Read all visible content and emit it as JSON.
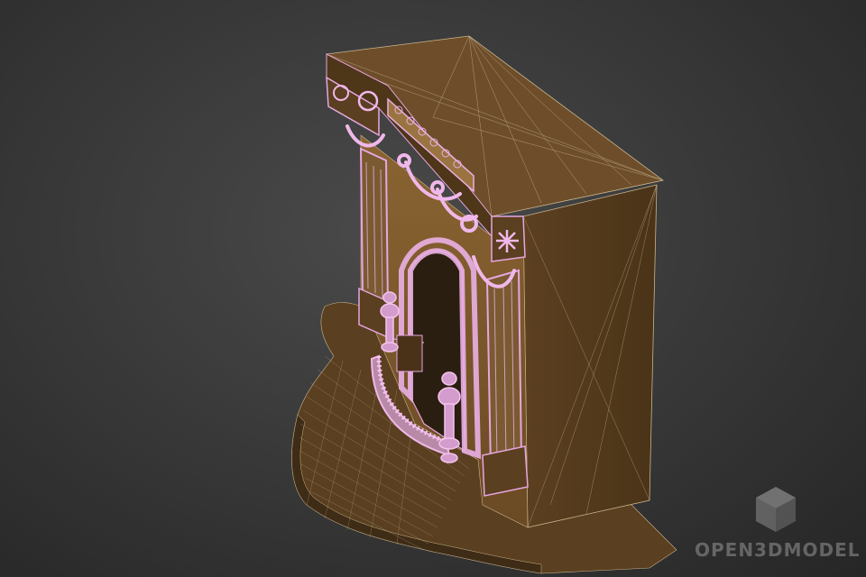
{
  "scene": {
    "subject": "fireplace-wireframe-model",
    "colors": {
      "background": "#3a3a3a",
      "body": "#6a4a26",
      "body_dark": "#4a3218",
      "body_light": "#8a6636",
      "wire_ornament": "#e6a6e0",
      "wire_body": "#c9b58e"
    }
  },
  "watermark": {
    "text": "OPEN3DMODEL",
    "icon": "cube-logo-icon"
  }
}
